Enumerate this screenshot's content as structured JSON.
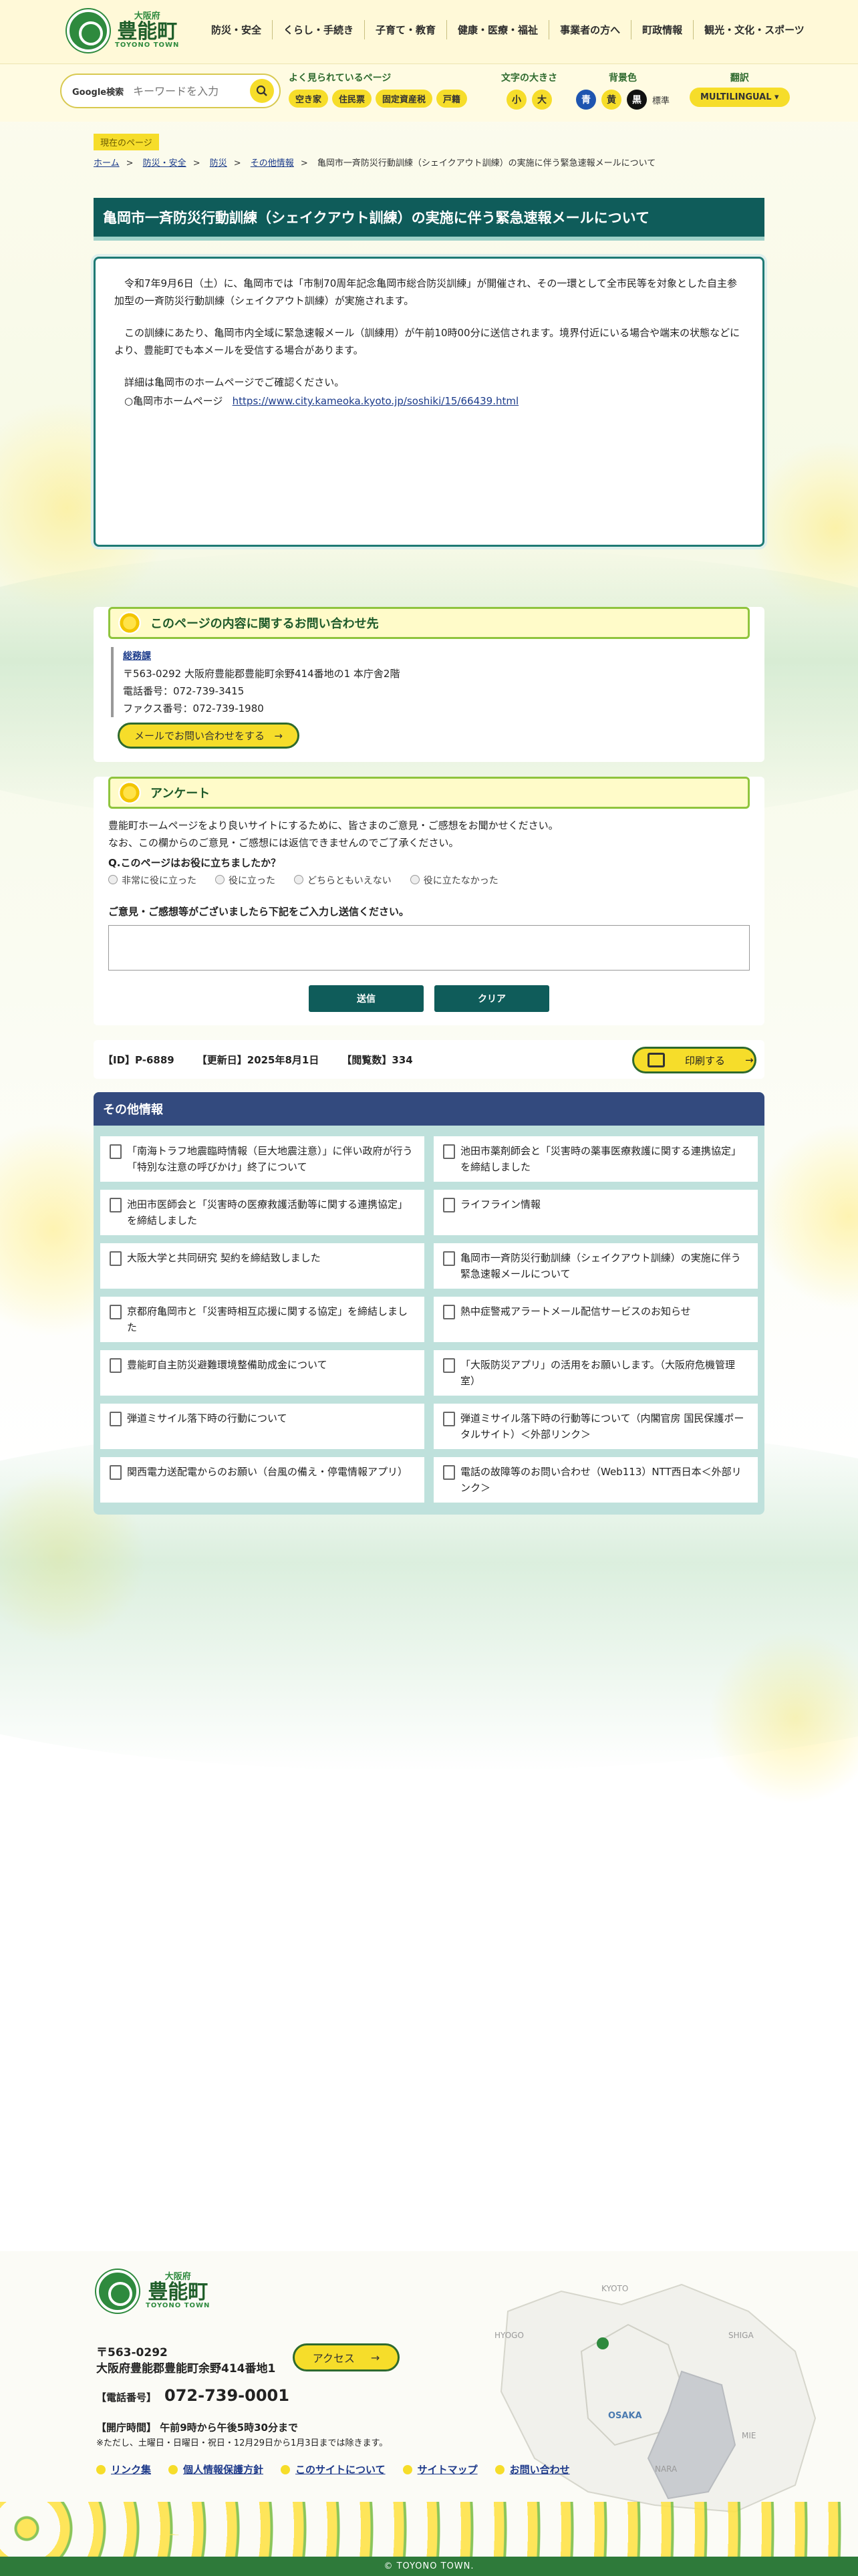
{
  "header": {
    "logo": {
      "pref": "大阪府",
      "name": "豊能町",
      "roman": "TOYONO TOWN"
    },
    "nav": [
      "防災・安全",
      "くらし・手続き",
      "子育て・教育",
      "健康・医療・福祉",
      "事業者の方へ",
      "町政情報",
      "観光・文化・スポーツ"
    ]
  },
  "toolbar": {
    "search_label": "Google検索",
    "search_placeholder": "キーワードを入力",
    "popular_title": "よく見られているページ",
    "popular": [
      "空き家",
      "住民票",
      "固定資産税",
      "戸籍"
    ],
    "font_size_title": "文字の大きさ",
    "font_small": "小",
    "font_large": "大",
    "bg_title": "背景色",
    "bg_blue": "青",
    "bg_yellow": "黄",
    "bg_black": "黒",
    "bg_standard": "標準",
    "translate_title": "翻訳",
    "translate_btn": "MULTILINGUAL"
  },
  "breadcrumb": {
    "badge": "現在のページ",
    "items": [
      "ホーム",
      "防災・安全",
      "防災",
      "その他情報"
    ],
    "current": "亀岡市一斉防災行動訓練（シェイクアウト訓練）の実施に伴う緊急速報メールについて"
  },
  "article": {
    "title": "亀岡市一斉防災行動訓練（シェイクアウト訓練）の実施に伴う緊急速報メールについて",
    "p1": "令和7年9月6日（土）に、亀岡市では「市制70周年記念亀岡市総合防災訓練」が開催され、その一環として全市民等を対象とした自主参加型の一斉防災行動訓練（シェイクアウト訓練）が実施されます。",
    "p2": "この訓練にあたり、亀岡市内全域に緊急速報メール（訓練用）が午前10時00分に送信されます。境界付近にいる場合や端末の状態などにより、豊能町でも本メールを受信する場合があります。",
    "p3": "詳細は亀岡市のホームページでご確認ください。",
    "link_label": "○亀岡市ホームページ",
    "link_url": "https://www.city.kameoka.kyoto.jp/soshiki/15/66439.html"
  },
  "contact": {
    "heading": "このページの内容に関するお問い合わせ先",
    "dept": "総務課",
    "address": "〒563-0292 大阪府豊能郡豊能町余野414番地の1 本庁舎2階",
    "tel": "電話番号：072-739-3415",
    "fax": "ファクス番号：072-739-1980",
    "mail_btn": "メールでお問い合わせをする"
  },
  "survey": {
    "heading": "アンケート",
    "intro1": "豊能町ホームページをより良いサイトにするために、皆さまのご意見・ご感想をお聞かせください。",
    "intro2": "なお、この欄からのご意見・ご感想には返信できませんのでご了承ください。",
    "question": "Q.このページはお役に立ちましたか？",
    "options": [
      "非常に役に立った",
      "役に立った",
      "どちらともいえない",
      "役に立たなかった"
    ],
    "feedback_label": "ご意見・ご感想等がございましたら下記をご入力し送信ください。",
    "submit": "送信",
    "clear": "クリア"
  },
  "meta": {
    "id": "【ID】P-6889",
    "updated": "【更新日】2025年8月1日",
    "views": "【閲覧数】334",
    "print": "印刷する"
  },
  "other": {
    "heading": "その他情報",
    "items": [
      "「南海トラフ地震臨時情報（巨大地震注意）」に伴い政府が行う「特別な注意の呼びかけ」終了について",
      "池田市薬剤師会と「災害時の薬事医療救護に関する連携協定」を締結しました",
      "池田市医師会と「災害時の医療救護活動等に関する連携協定」を締結しました",
      "ライフライン情報",
      "大阪大学と共同研究 契約を締結致しました",
      "亀岡市一斉防災行動訓練（シェイクアウト訓練）の実施に伴う緊急速報メールについて",
      "京都府亀岡市と「災害時相互応援に関する協定」を締結しました",
      "熱中症警戒アラートメール配信サービスのお知らせ",
      "豊能町自主防災避難環境整備助成金について",
      "「大阪防災アプリ」の活用をお願いします。（大阪府危機管理室）",
      "弾道ミサイル落下時の行動について",
      "弾道ミサイル落下時の行動等について（内閣官房 国民保護ポータルサイト）＜外部リンク＞",
      "関西電力送配電からのお願い（台風の備え・停電情報アプリ）",
      "電話の故障等のお問い合わせ（Web113）NTT西日本＜外部リンク＞"
    ]
  },
  "footer": {
    "pref": "大阪府",
    "name": "豊能町",
    "roman": "TOYONO TOWN",
    "zip": "〒563-0292",
    "address": "大阪府豊能郡豊能町余野414番地1",
    "access": "アクセス",
    "tel_label": "【電話番号】",
    "tel": "072-739-0001",
    "hours": "【開庁時間】 午前9時から午後5時30分まで",
    "hours_note": "※ただし、土曜日・日曜日・祝日・12月29日から1月3日までは除きます。",
    "links": [
      "リンク集",
      "個人情報保護方針",
      "このサイトについて",
      "サイトマップ",
      "お問い合わせ"
    ],
    "map_labels": [
      "KYOTO",
      "HYOGO",
      "SHIGA",
      "OSAKA",
      "MIE",
      "NARA"
    ],
    "copyright": "© TOYONO TOWN."
  }
}
